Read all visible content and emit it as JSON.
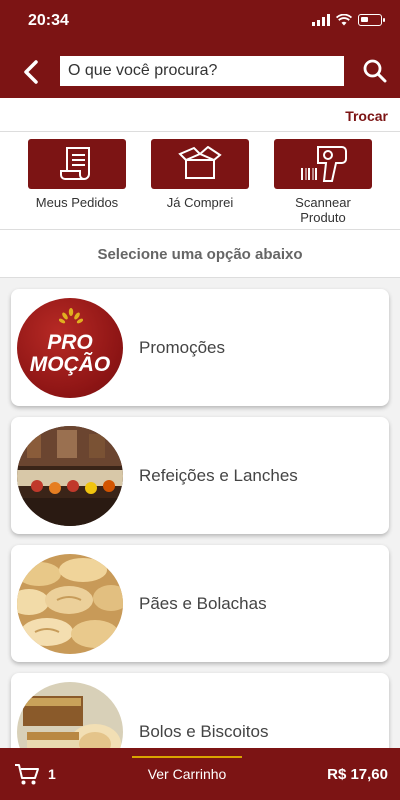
{
  "status": {
    "time": "20:34",
    "icons": [
      "signal-icon",
      "wifi-icon",
      "battery-icon"
    ]
  },
  "header": {
    "back_icon": "chevron-left-icon",
    "search_placeholder": "O que você procura?",
    "search_icon": "search-icon",
    "color": "#7c1414"
  },
  "store": {
    "change_label": "Trocar"
  },
  "actions": [
    {
      "label": "Meus Pedidos",
      "icon": "receipt-icon"
    },
    {
      "label": "Já Comprei",
      "icon": "open-box-icon"
    },
    {
      "label": "Scannear Produto",
      "icon": "barcode-scanner-icon"
    }
  ],
  "section_title": "Selecione uma opção abaixo",
  "categories": [
    {
      "label": "Promoções",
      "image": "promo-badge",
      "badge_text": [
        "PRO",
        "MOÇÃO"
      ]
    },
    {
      "label": "Refeições e Lanches",
      "image": "buffet-photo"
    },
    {
      "label": "Pães e Bolachas",
      "image": "bread-photo"
    },
    {
      "label": "Bolos e Biscoitos",
      "image": "cake-photo"
    }
  ],
  "cart": {
    "icon": "cart-icon",
    "count": "1",
    "view_label": "Ver Carrinho",
    "total": "R$ 17,60",
    "accent": "#d9a400"
  }
}
